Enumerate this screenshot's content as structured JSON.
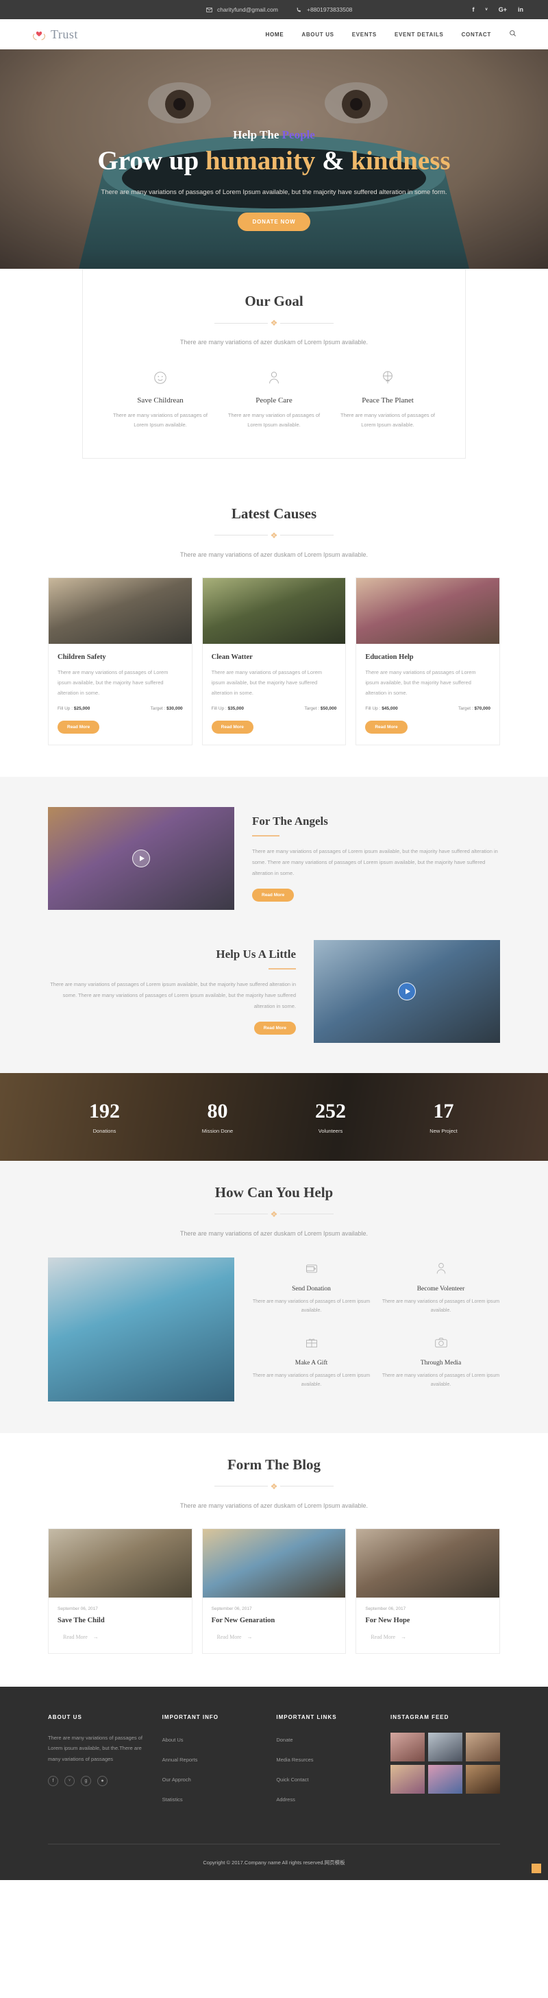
{
  "topbar": {
    "email": "charityfund@gmail.com",
    "phone": "+8801973833508",
    "social": [
      {
        "name": "facebook",
        "glyph": "f"
      },
      {
        "name": "twitter",
        "glyph": "ᵛ"
      },
      {
        "name": "google-plus",
        "glyph": "G+"
      },
      {
        "name": "linkedin",
        "glyph": "in"
      }
    ]
  },
  "brand": {
    "name": "Trust"
  },
  "nav": {
    "items": [
      {
        "label": "HOME"
      },
      {
        "label": "ABOUT US"
      },
      {
        "label": "EVENTS"
      },
      {
        "label": "EVENT DETAILS"
      },
      {
        "label": "CONTACT"
      }
    ],
    "search_label": "Search"
  },
  "hero": {
    "eyebrow_plain": "Help The ",
    "eyebrow_accent": "People",
    "title_a": "Grow up ",
    "title_b": "humanity",
    "title_c": " & ",
    "title_d": "kindness",
    "text": "There are many variations of passages of Lorem Ipsum available, but the majority have suffered alteration in some form.",
    "cta": "DONATE NOW"
  },
  "goal": {
    "title": "Our Goal",
    "subtitle": "There are many variations of azer duskam of Lorem Ipsum available.",
    "items": [
      {
        "icon": "smiley-icon",
        "name": "Save Childrean",
        "desc": "There are many variations of passages of Lorem Ipsum available."
      },
      {
        "icon": "person-icon",
        "name": "People Care",
        "desc": "There are many variation of passages of Lorem Ipsum available."
      },
      {
        "icon": "globe-icon",
        "name": "Peace The Planet",
        "desc": "There are many variations of passages of Lorem Ipsum available."
      }
    ]
  },
  "causes": {
    "title": "Latest Causes",
    "subtitle": "There are many variations of azer duskam of Lorem Ipsum available.",
    "fillup_label": "Fill Up :",
    "target_label": "Target :",
    "read_more": "Read More",
    "items": [
      {
        "title": "Children Safety",
        "text": "There are many variations of passages of Lorem ipsum available, but the majority have suffered alteration in some.",
        "fillup": "$25,000",
        "target": "$30,000"
      },
      {
        "title": "Clean Watter",
        "text": "There are many variations of passages of Lorem ipsum available, but the majority have suffered alteration in some.",
        "fillup": "$35,000",
        "target": "$50,000"
      },
      {
        "title": "Education Help",
        "text": "There are many variations of passages of Lorem ipsum available, but the majority have suffered alteration in some.",
        "fillup": "$45,000",
        "target": "$70,000"
      }
    ]
  },
  "angels": {
    "title": "For The Angels",
    "text": "There are many variations of passages of Lorem ipsum available, but the majority have suffered alteration in some. There are many variations of passages of Lorem ipsum available, but the majority have suffered alteration in some.",
    "cta": "Read More"
  },
  "help_little": {
    "title": "Help Us A Little",
    "text": "There are many variations of passages of Lorem ipsum available, but the majority have suffered alteration in some. There are many variations of passages of Lorem ipsum available, but the majority have suffered alteration in some.",
    "cta": "Read More"
  },
  "counters": [
    {
      "value": "192",
      "label": "Donations"
    },
    {
      "value": "80",
      "label": "Mission Done"
    },
    {
      "value": "252",
      "label": "Volunteers"
    },
    {
      "value": "17",
      "label": "New Project"
    }
  ],
  "how_help": {
    "title": "How Can You Help",
    "subtitle": "There are many variations of azer duskam of Lorem Ipsum available.",
    "items": [
      {
        "icon": "wallet-icon",
        "name": "Send Donation",
        "desc": "There are many variations of passages of Lorem ipsum available."
      },
      {
        "icon": "person-icon",
        "name": "Become Volenteer",
        "desc": "There are many variations of passages of Lorem ipsum available."
      },
      {
        "icon": "gift-icon",
        "name": "Make A Gift",
        "desc": "There are many variations of passages of Lorem ipsum available."
      },
      {
        "icon": "camera-icon",
        "name": "Through Media",
        "desc": "There are many variations of passages of Lorem ipsum available."
      }
    ]
  },
  "blog": {
    "title": "Form The Blog",
    "subtitle": "There are many variations of azer duskam of Lorem Ipsum available.",
    "read_more": "Read More",
    "posts": [
      {
        "date": "September 06, 2017",
        "title": "Save The Child"
      },
      {
        "date": "September 06, 2017",
        "title": "For New Genaration"
      },
      {
        "date": "September 06, 2017",
        "title": "For New Hope"
      }
    ]
  },
  "footer": {
    "about": {
      "title": "ABOUT US",
      "text": "There are many variations of passages of Lorem ipsum available, but the.There are many variations of passages",
      "social": [
        {
          "name": "facebook",
          "glyph": "f"
        },
        {
          "name": "twitter",
          "glyph": "ᵛ"
        },
        {
          "name": "google-plus",
          "glyph": "g"
        },
        {
          "name": "dribbble",
          "glyph": "●"
        }
      ]
    },
    "important_info": {
      "title": "IMPORTANT INFO",
      "links": [
        "About Us",
        "Annual Reports",
        "Our Approch",
        "Statistics"
      ]
    },
    "important_links": {
      "title": "IMPORTANT LINKS",
      "links": [
        "Donate",
        "Media Resurces",
        "Quick Contact",
        "Address"
      ]
    },
    "instagram": {
      "title": "INSTAGRAM FEED"
    },
    "copyright": "Copyright © 2017.Company name All rights reserved.网页模板"
  }
}
